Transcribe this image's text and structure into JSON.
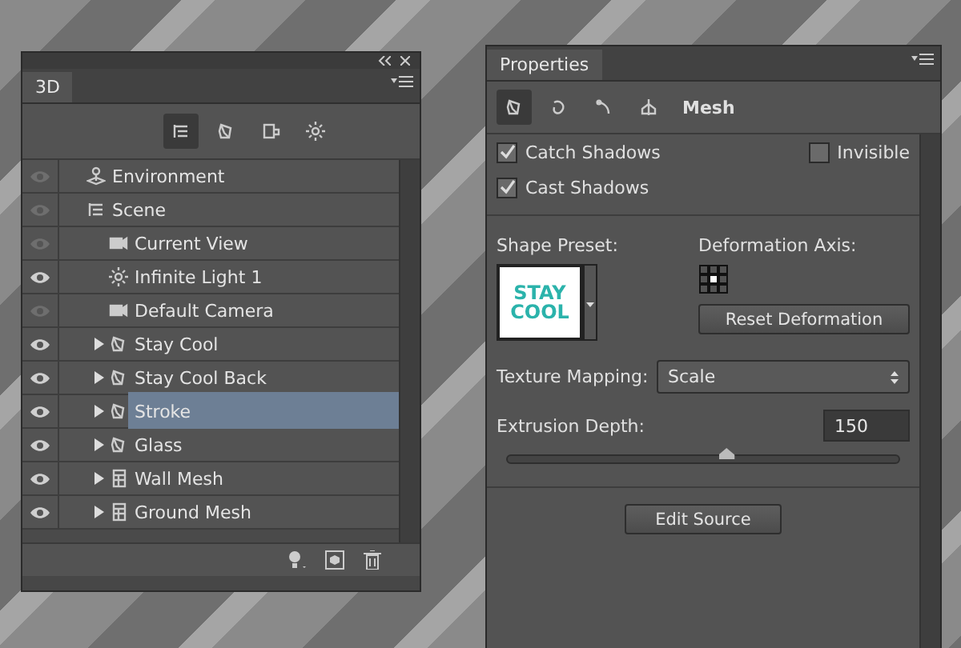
{
  "panel_3d": {
    "tab": "3D",
    "toolbar": [
      {
        "kind": "scene",
        "selected": true
      },
      {
        "kind": "mesh",
        "selected": false
      },
      {
        "kind": "material",
        "selected": false
      },
      {
        "kind": "light",
        "selected": false
      }
    ],
    "tree": [
      {
        "label": "Environment",
        "kind": "environment",
        "visible": false,
        "selected": false
      },
      {
        "label": "Scene",
        "kind": "scene",
        "visible": false,
        "selected": false,
        "children": [
          {
            "label": "Current View",
            "kind": "camera",
            "visible": false,
            "selected": false
          },
          {
            "label": "Infinite Light 1",
            "kind": "light",
            "visible": true,
            "selected": false
          },
          {
            "label": "Default Camera",
            "kind": "camera",
            "visible": false,
            "selected": false
          },
          {
            "label": "Stay  Cool",
            "kind": "mesh",
            "visible": true,
            "selected": false,
            "expanded": false
          },
          {
            "label": "Stay  Cool Back",
            "kind": "mesh",
            "visible": true,
            "selected": false,
            "expanded": false
          },
          {
            "label": "Stroke",
            "kind": "mesh",
            "visible": true,
            "selected": true,
            "expanded": false
          },
          {
            "label": "Glass",
            "kind": "mesh",
            "visible": true,
            "selected": false,
            "expanded": false
          },
          {
            "label": "Wall Mesh",
            "kind": "box",
            "visible": true,
            "selected": false,
            "expanded": false
          },
          {
            "label": "Ground Mesh",
            "kind": "box",
            "visible": true,
            "selected": false,
            "expanded": false
          }
        ]
      }
    ]
  },
  "properties": {
    "tab": "Properties",
    "toolbar": [
      {
        "kind": "mesh",
        "selected": true
      },
      {
        "kind": "deform",
        "selected": false
      },
      {
        "kind": "cap",
        "selected": false
      },
      {
        "kind": "coordinates",
        "selected": false
      }
    ],
    "section": "Mesh",
    "catch_shadows": {
      "label": "Catch Shadows",
      "checked": true
    },
    "cast_shadows": {
      "label": "Cast Shadows",
      "checked": true
    },
    "invisible": {
      "label": "Invisible",
      "checked": false
    },
    "shape_preset": {
      "label": "Shape Preset:",
      "preview": "STAY COOL"
    },
    "deformation_axis": {
      "label": "Deformation Axis:"
    },
    "reset_button": "Reset Deformation",
    "texture_mapping": {
      "label": "Texture Mapping:",
      "value": "Scale"
    },
    "extrusion_depth": {
      "label": "Extrusion Depth:",
      "value": "150",
      "level": 0.56
    },
    "edit_button": "Edit Source"
  }
}
